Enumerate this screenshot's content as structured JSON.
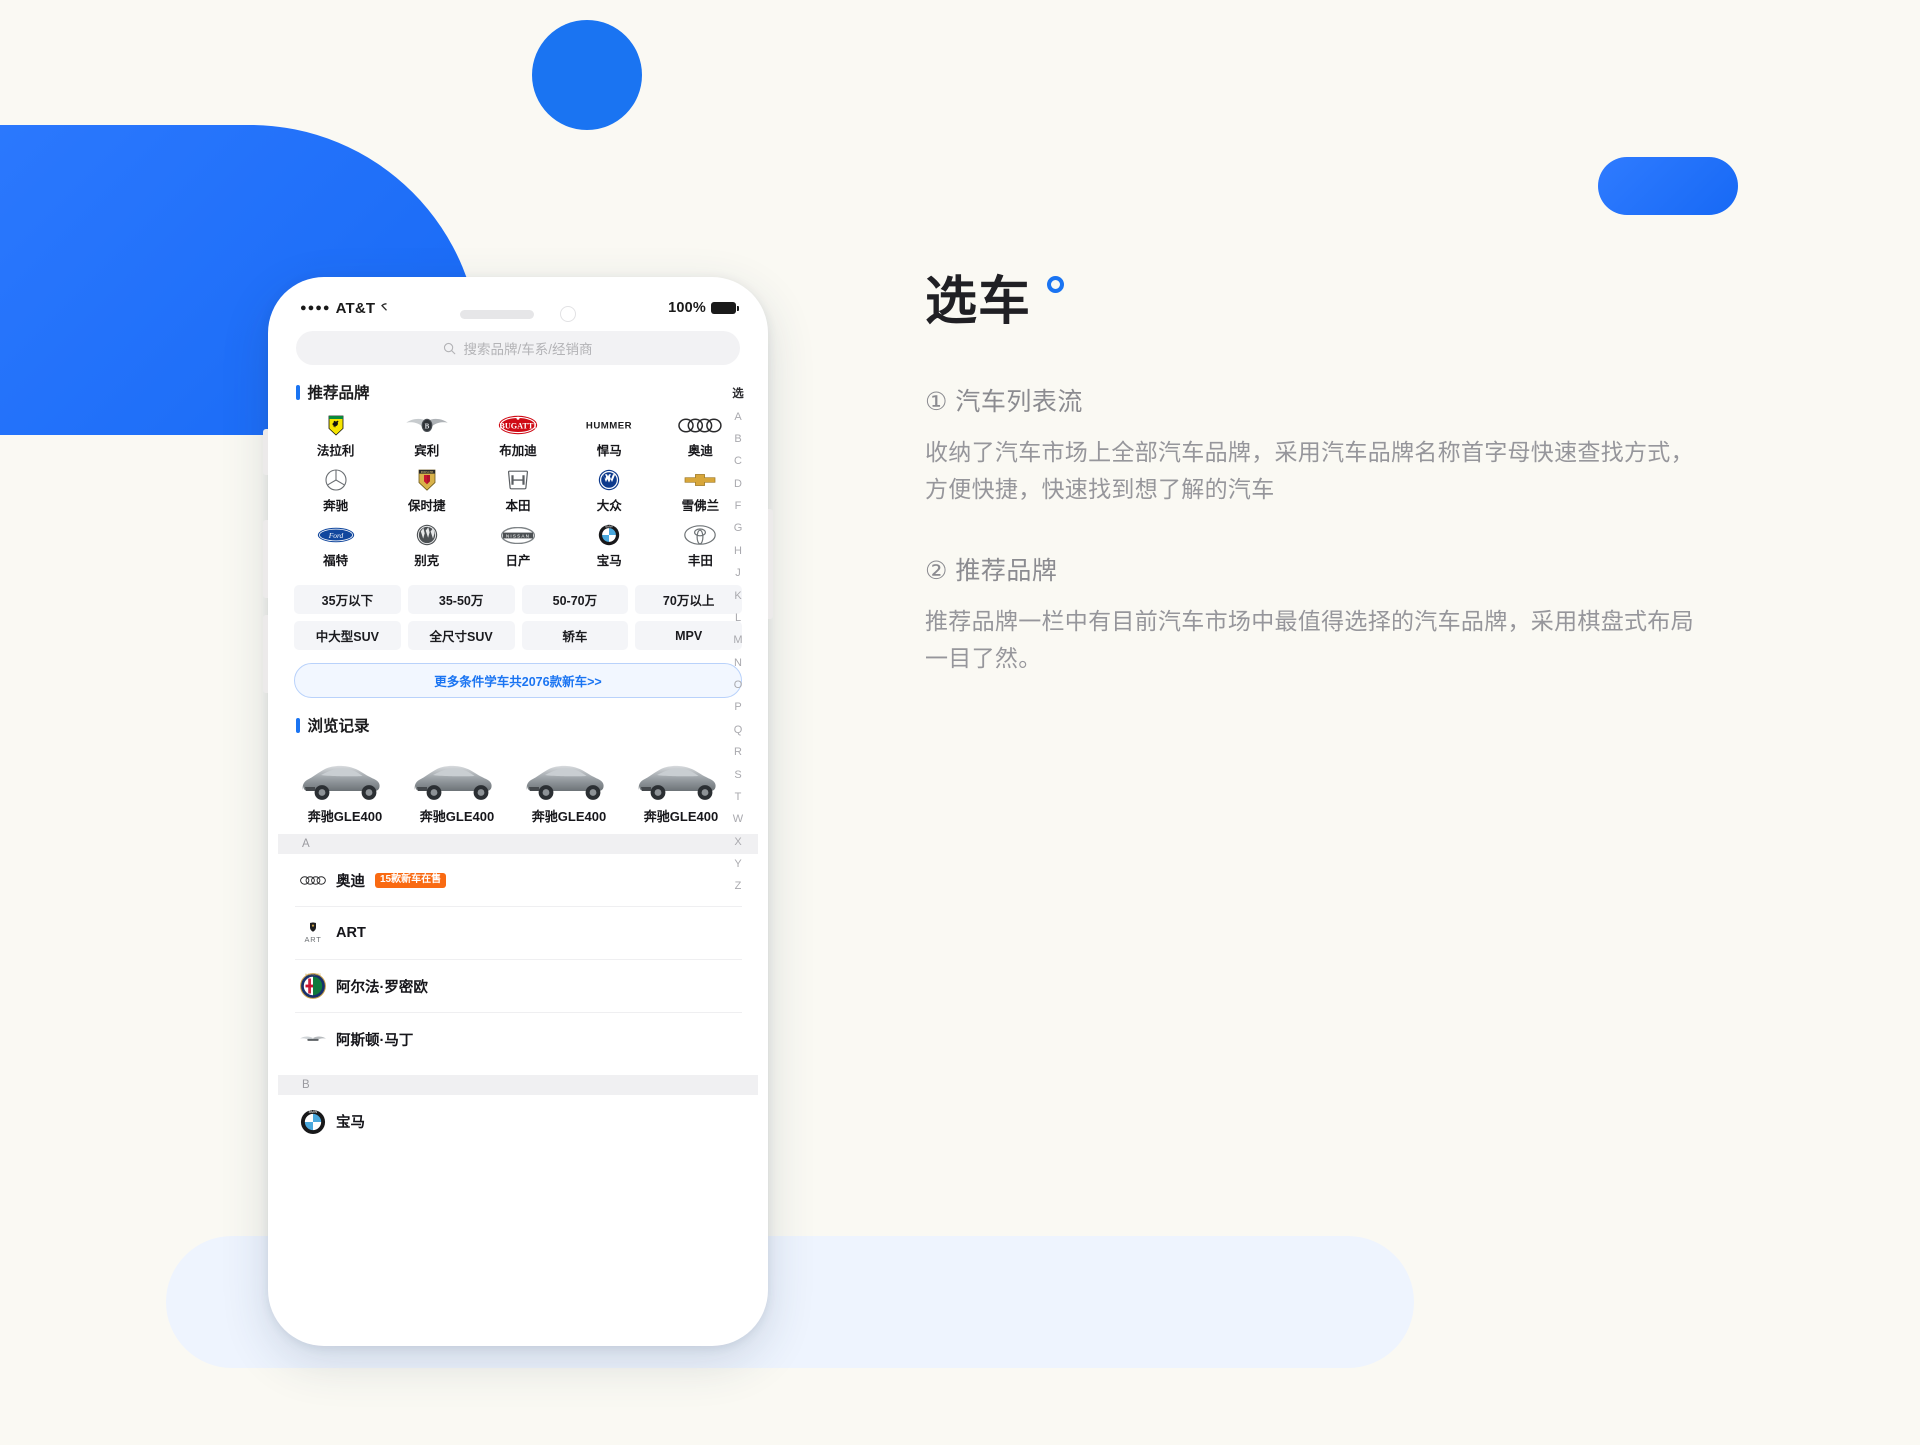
{
  "background": {
    "page_bg": "#faf9f3",
    "accent_blue": "#1a74f2",
    "soft_blue": "#eef4fe"
  },
  "phone": {
    "statusbar": {
      "signal_dots": "●●●●",
      "carrier": "AT&T",
      "wifi": "wifi-icon",
      "battery_pct": "100%"
    },
    "search": {
      "placeholder": "搜索品牌/车系/经销商",
      "icon": "search-icon"
    },
    "recommended_section": {
      "title": "推荐品牌",
      "brands": [
        {
          "name": "法拉利",
          "logo": "ferrari-logo"
        },
        {
          "name": "宾利",
          "logo": "bentley-logo"
        },
        {
          "name": "布加迪",
          "logo": "bugatti-logo"
        },
        {
          "name": "悍马",
          "logo": "hummer-logo"
        },
        {
          "name": "奥迪",
          "logo": "audi-logo"
        },
        {
          "name": "奔驰",
          "logo": "mercedes-logo"
        },
        {
          "name": "保时捷",
          "logo": "porsche-logo"
        },
        {
          "name": "本田",
          "logo": "honda-logo"
        },
        {
          "name": "大众",
          "logo": "volkswagen-logo"
        },
        {
          "name": "雪佛兰",
          "logo": "chevrolet-logo"
        },
        {
          "name": "福特",
          "logo": "ford-logo"
        },
        {
          "name": "别克",
          "logo": "buick-logo"
        },
        {
          "name": "日产",
          "logo": "nissan-logo"
        },
        {
          "name": "宝马",
          "logo": "bmw-logo"
        },
        {
          "name": "丰田",
          "logo": "toyota-logo"
        }
      ]
    },
    "filters": [
      "35万以下",
      "35-50万",
      "50-70万",
      "70万以上",
      "中大型SUV",
      "全尺寸SUV",
      "轿车",
      "MPV"
    ],
    "more_button": "更多条件学车共2076款新车>>",
    "history_section": {
      "title": "浏览记录",
      "items": [
        {
          "name": "奔驰GLE400"
        },
        {
          "name": "奔驰GLE400"
        },
        {
          "name": "奔驰GLE400"
        },
        {
          "name": "奔驰GLE400"
        }
      ]
    },
    "brand_list": [
      {
        "type": "letter",
        "label": "A"
      },
      {
        "type": "brand",
        "name": "奥迪",
        "logo": "audi-logo",
        "badge": "15款新车在售"
      },
      {
        "type": "brand",
        "name": "ART",
        "logo": "art-logo",
        "badge": ""
      },
      {
        "type": "brand",
        "name": "阿尔法·罗密欧",
        "logo": "alfa-romeo-logo",
        "badge": ""
      },
      {
        "type": "brand",
        "name": "阿斯顿·马丁",
        "logo": "aston-martin-logo",
        "badge": ""
      },
      {
        "type": "letter",
        "label": "B"
      },
      {
        "type": "brand",
        "name": "宝马",
        "logo": "bmw-logo",
        "badge": ""
      }
    ],
    "alphabet_index": [
      "选",
      "A",
      "B",
      "C",
      "D",
      "F",
      "G",
      "H",
      "J",
      "K",
      "L",
      "M",
      "N",
      "O",
      "P",
      "Q",
      "R",
      "S",
      "T",
      "W",
      "X",
      "Y",
      "Z"
    ]
  },
  "right_panel": {
    "title": "选车",
    "features": [
      {
        "head": "① 汽车列表流",
        "body": "收纳了汽车市场上全部汽车品牌，采用汽车品牌名称首字母快速查找方式，方便快捷，快速找到想了解的汽车"
      },
      {
        "head": "② 推荐品牌",
        "body": "推荐品牌一栏中有目前汽车市场中最值得选择的汽车品牌，采用棋盘式布局一目了然。"
      }
    ]
  }
}
